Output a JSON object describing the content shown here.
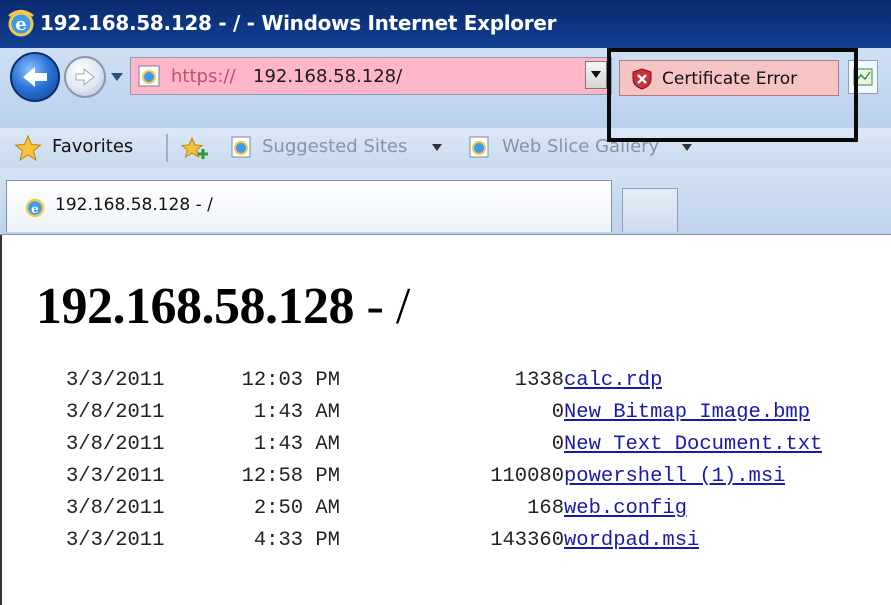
{
  "window": {
    "title": "192.168.58.128 - / - Windows Internet Explorer"
  },
  "address_bar": {
    "url_scheme": "https://",
    "url_host": "192.168.58.128/",
    "bg_color": "#ffb6c8"
  },
  "certificate": {
    "label": "Certificate Error",
    "icon": "shield-error-icon",
    "color": "#f7c4c4"
  },
  "favorites_bar": {
    "favorites_label": "Favorites",
    "items": [
      {
        "label": "Suggested Sites"
      },
      {
        "label": "Web Slice Gallery"
      }
    ]
  },
  "tab": {
    "label": "192.168.58.128 - /"
  },
  "page": {
    "title_host": "192.168.58.128",
    "title_sep": " - /",
    "files": [
      {
        "date": "3/3/2011",
        "time": "12:03 PM",
        "size": "1338",
        "name": "calc.rdp"
      },
      {
        "date": "3/8/2011",
        "time": "1:43 AM",
        "size": "0",
        "name": "New Bitmap Image.bmp"
      },
      {
        "date": "3/8/2011",
        "time": "1:43 AM",
        "size": "0",
        "name": "New Text Document.txt"
      },
      {
        "date": "3/3/2011",
        "time": "12:58 PM",
        "size": "110080",
        "name": "powershell (1).msi"
      },
      {
        "date": "3/8/2011",
        "time": "2:50 AM",
        "size": "168",
        "name": "web.config"
      },
      {
        "date": "3/3/2011",
        "time": "4:33 PM",
        "size": "143360",
        "name": "wordpad.msi"
      }
    ]
  },
  "colors": {
    "titlebar": "#0c3480",
    "link": "#1a1aa8",
    "highlight_frame": "#0a0a0a"
  }
}
